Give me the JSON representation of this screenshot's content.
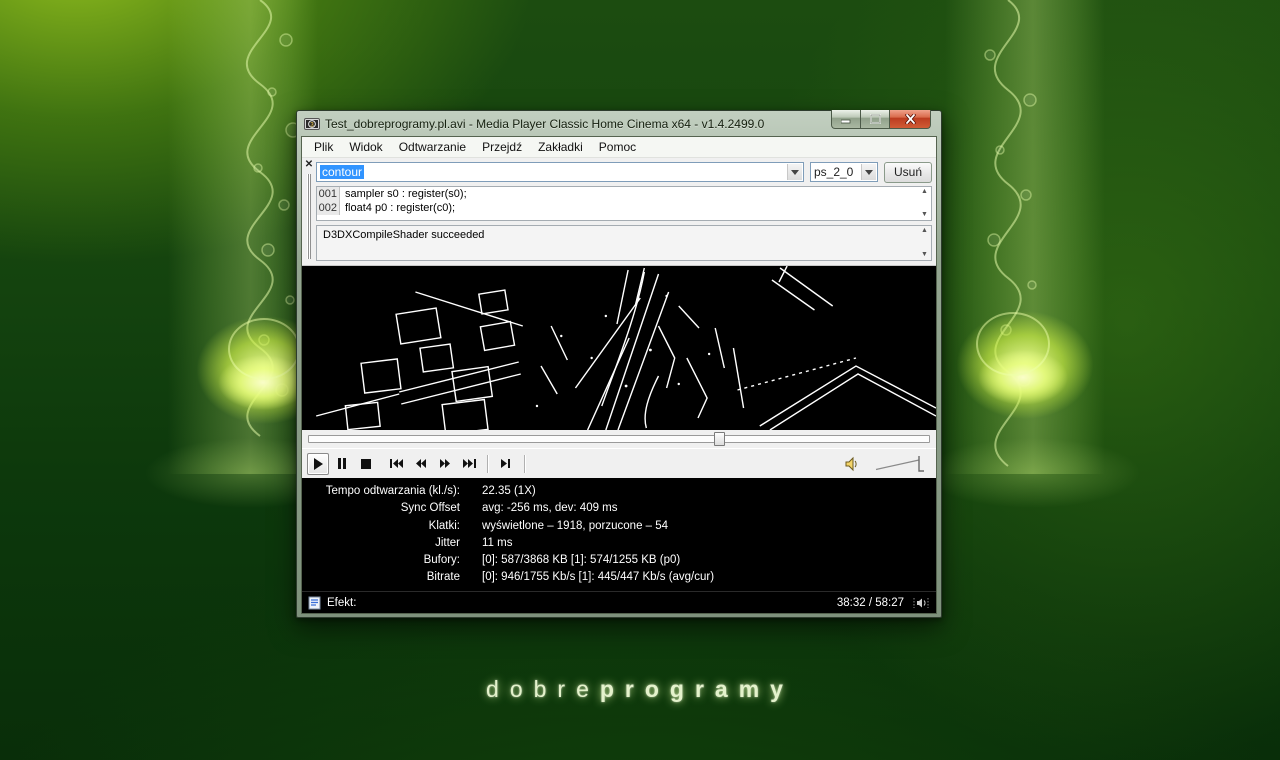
{
  "window": {
    "title": "Test_dobreprogramy.pl.avi - Media Player Classic Home Cinema x64 - v1.4.2499.0",
    "menu": [
      "Plik",
      "Widok",
      "Odtwarzanie",
      "Przejdź",
      "Zakładki",
      "Pomoc"
    ],
    "shader": {
      "name": "contour",
      "profile": "ps_2_0",
      "delete_label": "Usuń",
      "lines": [
        {
          "num": "001",
          "code": "sampler s0 : register(s0);"
        },
        {
          "num": "002",
          "code": "float4 p0 : register(c0);"
        }
      ],
      "output": "D3DXCompileShader succeeded"
    },
    "player": {
      "seek_percent": 65,
      "volume_percent": 100
    },
    "stats": {
      "rows": [
        {
          "label": "Tempo odtwarzania (kl./s):",
          "value": "22.35 (1X)"
        },
        {
          "label": "Sync Offset",
          "value": "avg: -256 ms, dev: 409 ms"
        },
        {
          "label": "Klatki:",
          "value": "wyświetlone – 1918, porzucone – 54"
        },
        {
          "label": "Jitter",
          "value": "11 ms"
        },
        {
          "label": "Bufory:",
          "value": "[0]: 587/3868 KB [1]: 574/1255 KB (p0)"
        },
        {
          "label": "Bitrate",
          "value": "[0]: 946/1755 Kb/s [1]: 445/447 Kb/s (avg/cur)"
        }
      ]
    },
    "status": {
      "left_label": "Efekt:",
      "time": "38:32 / 58:27"
    }
  },
  "desktop": {
    "logo": {
      "light": "dobre",
      "bold": "programy"
    }
  },
  "colors": {
    "selection": "#3194ff",
    "close_button": "#bc3c20",
    "desktop_green": "#14430e"
  }
}
